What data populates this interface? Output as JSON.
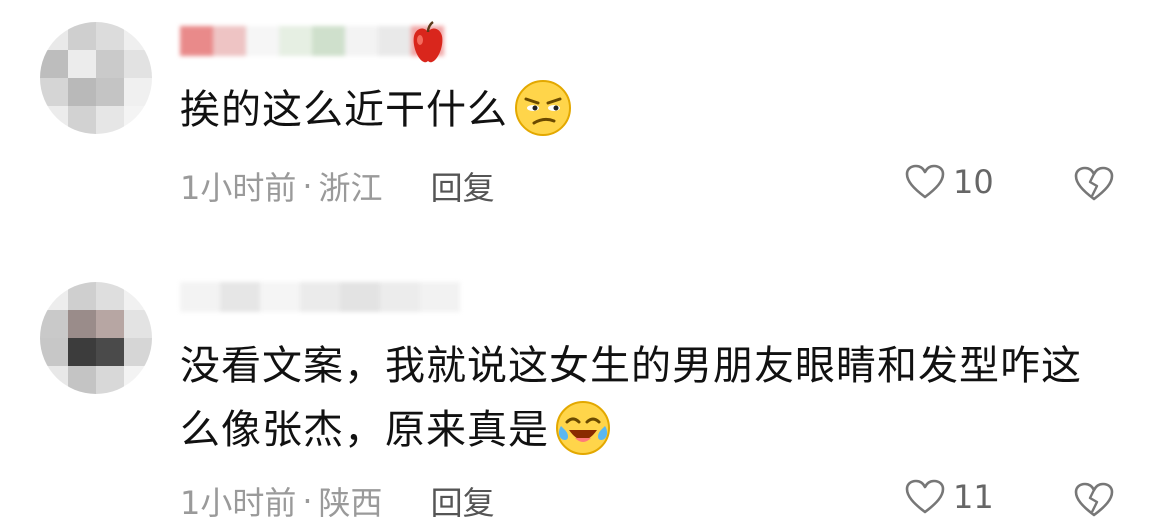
{
  "comments": [
    {
      "text": "挨的这么近干什么",
      "emoji_icon": "smirking-face-icon",
      "time": "1小时前",
      "separator": "·",
      "location": "浙江",
      "reply_label": "回复",
      "likes": "10",
      "username_badge_icon": "apple-icon"
    },
    {
      "text": "没看文案，我就说这女生的男朋友眼睛和发型咋这么像张杰，原来真是",
      "emoji_icon": "tears-of-joy-face-icon",
      "time": "1小时前",
      "separator": "·",
      "location": "陕西",
      "reply_label": "回复",
      "likes": "11"
    }
  ],
  "colors": {
    "text": "#111111",
    "meta": "#9a9a9a",
    "reply": "#555555",
    "icon": "#777777"
  }
}
